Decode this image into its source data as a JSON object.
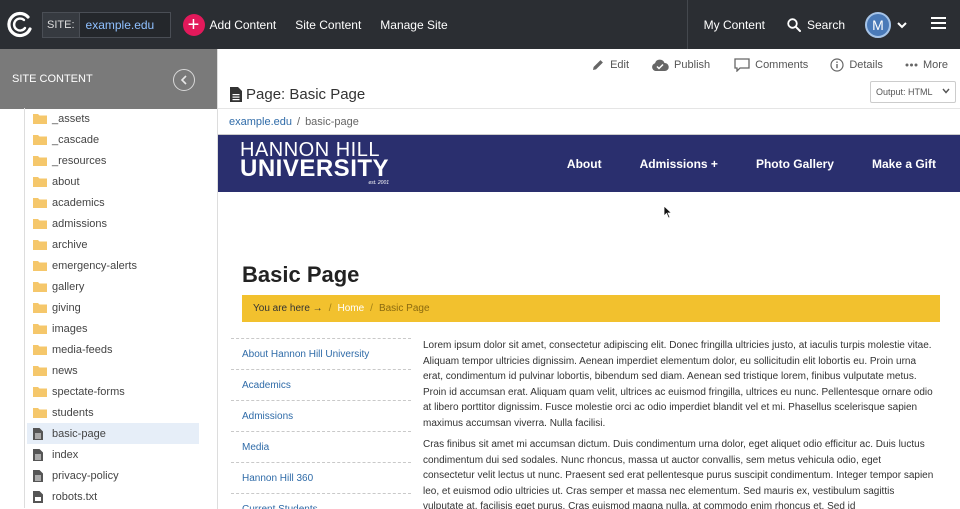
{
  "topbar": {
    "site_label": "SITE:",
    "site_value": "example.edu",
    "add_content": "Add Content",
    "site_content": "Site Content",
    "manage_site": "Manage Site",
    "my_content": "My Content",
    "search": "Search",
    "avatar_initial": "M"
  },
  "sidebar": {
    "title": "SITE CONTENT",
    "items": [
      {
        "label": "_assets",
        "type": "folder"
      },
      {
        "label": "_cascade",
        "type": "folder"
      },
      {
        "label": "_resources",
        "type": "folder"
      },
      {
        "label": "about",
        "type": "folder"
      },
      {
        "label": "academics",
        "type": "folder"
      },
      {
        "label": "admissions",
        "type": "folder"
      },
      {
        "label": "archive",
        "type": "folder"
      },
      {
        "label": "emergency-alerts",
        "type": "folder"
      },
      {
        "label": "gallery",
        "type": "folder"
      },
      {
        "label": "giving",
        "type": "folder"
      },
      {
        "label": "images",
        "type": "folder"
      },
      {
        "label": "media-feeds",
        "type": "folder"
      },
      {
        "label": "news",
        "type": "folder"
      },
      {
        "label": "spectate-forms",
        "type": "folder"
      },
      {
        "label": "students",
        "type": "folder"
      },
      {
        "label": "basic-page",
        "type": "page",
        "active": true
      },
      {
        "label": "index",
        "type": "page"
      },
      {
        "label": "privacy-policy",
        "type": "page"
      },
      {
        "label": "robots.txt",
        "type": "file"
      }
    ]
  },
  "actions": {
    "edit": "Edit",
    "publish": "Publish",
    "comments": "Comments",
    "details": "Details",
    "more": "More"
  },
  "page": {
    "title": "Page: Basic Page",
    "output": "Output: HTML",
    "crumb_site": "example.edu",
    "crumb_sep": "/",
    "crumb_page": "basic-page"
  },
  "preview": {
    "logo_line1": "HANNON HILL",
    "logo_line2": "UNIVERSITY",
    "logo_line3": "est. 2001",
    "menu": [
      "About",
      "Admissions +",
      "Photo Gallery",
      "Make a Gift"
    ],
    "heading": "Basic Page",
    "here_label": "You are here →",
    "here_sep": "/",
    "here_home": "Home",
    "here_current": "Basic Page",
    "subnav": [
      "About Hannon Hill University",
      "Academics",
      "Admissions",
      "Media",
      "Hannon Hill 360",
      "Current Students"
    ],
    "para1": "Lorem ipsum dolor sit amet, consectetur adipiscing elit. Donec fringilla ultricies justo, at iaculis turpis molestie vitae. Aliquam tempor ultricies dignissim. Aenean imperdiet elementum dolor, eu sollicitudin elit lobortis eu. Proin urna erat, condimentum id pulvinar lobortis, bibendum sed diam. Aenean sed tristique lorem, finibus vulputate metus. Proin id accumsan erat. Aliquam quam velit, ultrices ac euismod fringilla, ultrices eu nunc. Pellentesque ornare odio at libero porttitor dignissim. Fusce molestie orci ac odio imperdiet blandit vel et mi. Phasellus scelerisque sapien maximus accumsan viverra. Nulla facilisi.",
    "para2": "Cras finibus sit amet mi accumsan dictum. Duis condimentum urna dolor, eget aliquet odio efficitur ac. Duis luctus condimentum dui sed sodales. Nunc rhoncus, massa ut auctor convallis, sem metus vehicula odio, eget consectetur velit lectus ut nunc. Praesent sed erat pellentesque purus suscipit condimentum. Integer tempor sapien leo, et euismod odio ultricies ut. Cras semper et massa nec elementum. Sed mauris ex, vestibulum sagittis vulputate at, facilisis eget purus. Cras euismod magna nulla, at commodo enim rhoncus et. Sed id"
  }
}
